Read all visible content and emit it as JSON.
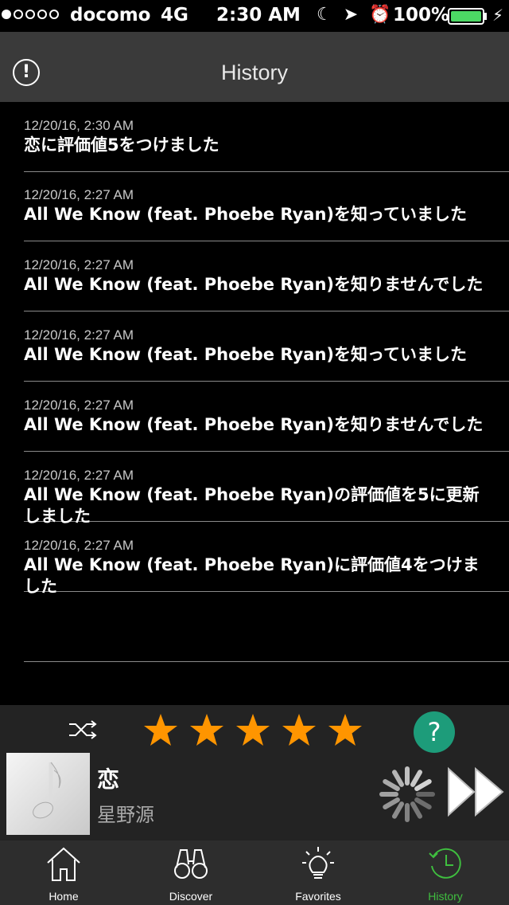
{
  "status_bar": {
    "signal_bars_filled": 1,
    "carrier": "docomo",
    "network": "4G",
    "time": "2:30 AM",
    "icons": [
      "moon-icon",
      "location-arrow-icon",
      "alarm-icon"
    ],
    "battery_percent": "100%",
    "battery_color": "#4cd964"
  },
  "nav": {
    "title": "History"
  },
  "history": [
    {
      "time": "12/20/16, 2:30 AM",
      "text": "恋に評価値5をつけました"
    },
    {
      "time": "12/20/16, 2:27 AM",
      "text": "All We Know (feat. Phoebe Ryan)を知っていました"
    },
    {
      "time": "12/20/16, 2:27 AM",
      "text": "All We Know (feat. Phoebe Ryan)を知りませんでした"
    },
    {
      "time": "12/20/16, 2:27 AM",
      "text": "All We Know (feat. Phoebe Ryan)を知っていました"
    },
    {
      "time": "12/20/16, 2:27 AM",
      "text": "All We Know (feat. Phoebe Ryan)を知りませんでした"
    },
    {
      "time": "12/20/16, 2:27 AM",
      "text": "All We Know (feat. Phoebe Ryan)の評価値を5に更新しました"
    },
    {
      "time": "12/20/16, 2:27 AM",
      "text": "All We Know (feat. Phoebe Ryan)に評価値4をつけました"
    },
    {
      "time": "",
      "text": ""
    }
  ],
  "player": {
    "rating": 5,
    "rating_max": 5,
    "star_color": "#ff9500",
    "help_label": "?",
    "help_color": "#1d9c7a",
    "track_title": "恋",
    "track_artist": "星野源"
  },
  "tabs": [
    {
      "label": "Home",
      "icon": "home-icon",
      "active": false
    },
    {
      "label": "Discover",
      "icon": "binoculars-icon",
      "active": false
    },
    {
      "label": "Favorites",
      "icon": "lightbulb-icon",
      "active": false
    },
    {
      "label": "History",
      "icon": "history-clock-icon",
      "active": true
    }
  ],
  "accent_color": "#3fbf3f"
}
